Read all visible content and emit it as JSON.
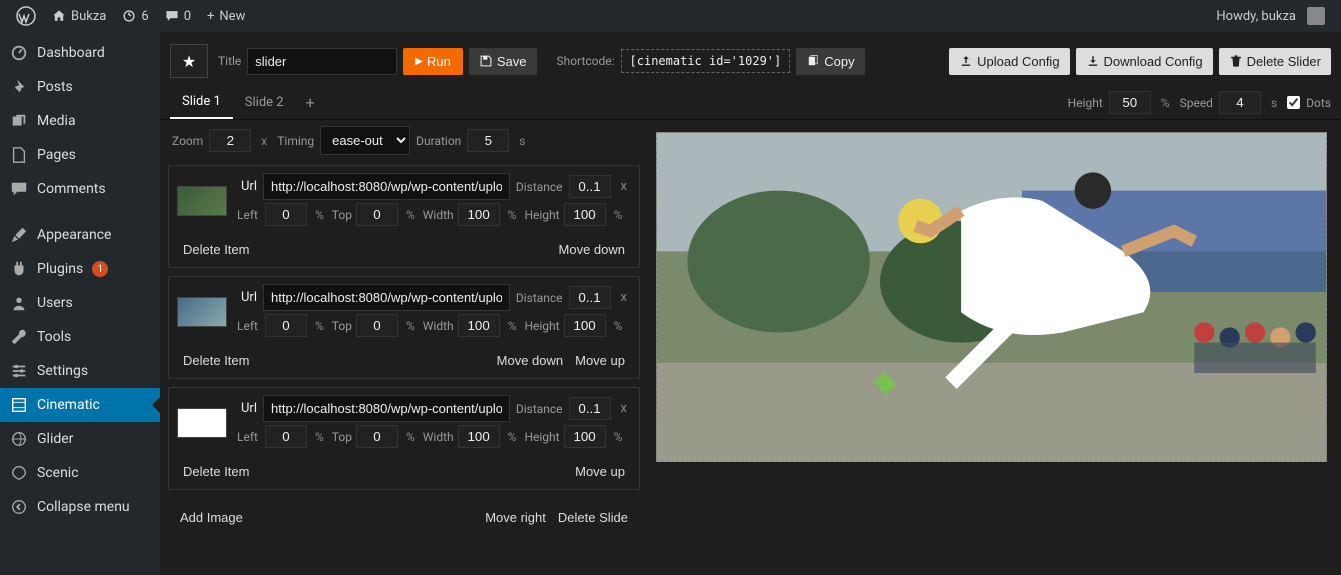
{
  "topbar": {
    "site": "Bukza",
    "updates": "6",
    "comments": "0",
    "new": "New",
    "howdy": "Howdy, bukza"
  },
  "sidebar": {
    "items": [
      "Dashboard",
      "Posts",
      "Media",
      "Pages",
      "Comments",
      "Appearance",
      "Plugins",
      "Users",
      "Tools",
      "Settings",
      "Cinematic",
      "Glider",
      "Scenic",
      "Collapse menu"
    ],
    "plugins_badge": "1"
  },
  "toolbar": {
    "title_lbl": "Title",
    "title_val": "slider",
    "run": "Run",
    "save": "Save",
    "shortcode_lbl": "Shortcode:",
    "shortcode_val": "[cinematic id='1029']",
    "copy": "Copy",
    "upload": "Upload Config",
    "download": "Download Config",
    "delete": "Delete Slider"
  },
  "tabs": {
    "t1": "Slide 1",
    "t2": "Slide 2",
    "height_lbl": "Height",
    "height_val": "50",
    "speed_lbl": "Speed",
    "speed_val": "4",
    "dots": "Dots"
  },
  "zoom": {
    "zoom_lbl": "Zoom",
    "zoom_val": "2",
    "x": "x",
    "timing_lbl": "Timing",
    "timing_val": "ease-out",
    "dur_lbl": "Duration",
    "dur_val": "5",
    "s": "s"
  },
  "lbls": {
    "url": "Url",
    "left": "Left",
    "top": "Top",
    "width": "Width",
    "height": "Height",
    "distance": "Distance",
    "pct": "%",
    "x": "x"
  },
  "items": [
    {
      "url": "http://localhost:8080/wp/wp-content/uplo",
      "dist": "0..1",
      "left": "0",
      "top": "0",
      "width": "100",
      "height": "100",
      "del": "Delete Item",
      "up": "",
      "down": "Move down"
    },
    {
      "url": "http://localhost:8080/wp/wp-content/uplo",
      "dist": "0..1",
      "left": "0",
      "top": "0",
      "width": "100",
      "height": "100",
      "del": "Delete Item",
      "up": "Move up",
      "down": "Move down"
    },
    {
      "url": "http://localhost:8080/wp/wp-content/uplo",
      "dist": "0..1",
      "left": "0",
      "top": "0",
      "width": "100",
      "height": "100",
      "del": "Delete Item",
      "up": "Move up",
      "down": ""
    }
  ],
  "bottom": {
    "add": "Add Image",
    "right": "Move right",
    "delslide": "Delete Slide"
  }
}
